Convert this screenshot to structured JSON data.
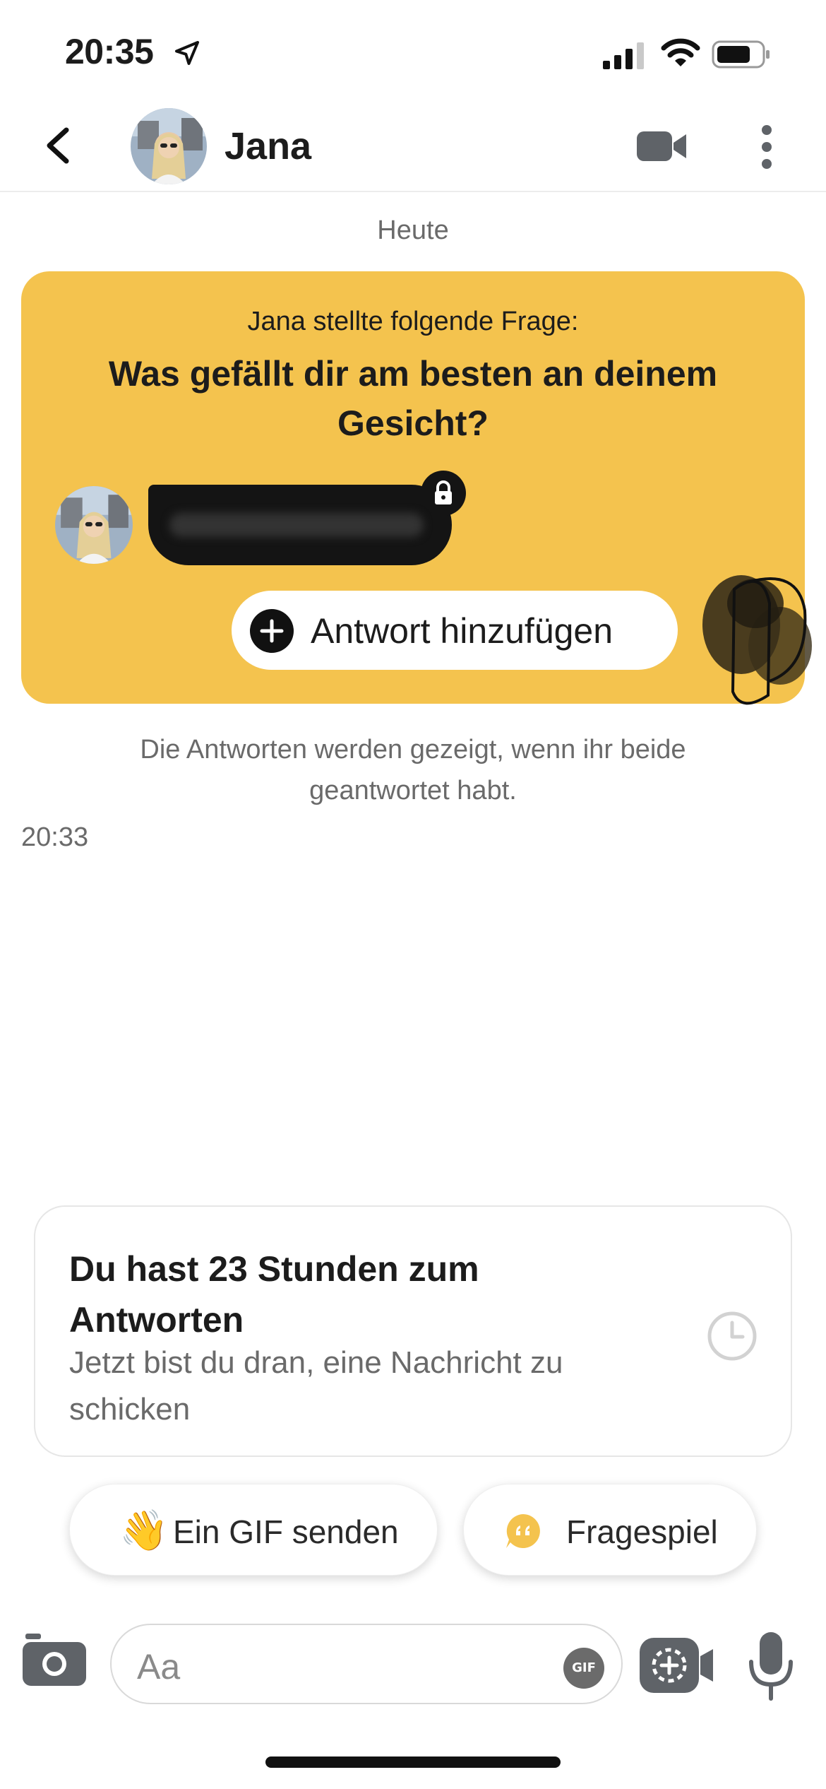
{
  "status_bar": {
    "time": "20:35",
    "icons": [
      "location-arrow-icon",
      "signal-icon",
      "wifi-icon",
      "battery-icon"
    ]
  },
  "header": {
    "contact_name": "Jana",
    "icons": [
      "back-icon",
      "avatar",
      "video-call-icon",
      "more-icon"
    ]
  },
  "chat": {
    "date_divider": "Heute",
    "question_card": {
      "intro": "Jana stellte folgende Frage:",
      "question": "Was gefällt dir am besten an deinem Gesicht?",
      "add_answer_label": "Antwort hinzufügen",
      "accent_color": "#f4c34e"
    },
    "info_text": "Die Antworten werden gezeigt, wenn ihr beide geantwortet habt.",
    "message_time": "20:33"
  },
  "timer_card": {
    "title": "Du hast 23 Stunden zum Antworten",
    "subtitle": "Jetzt bist du dran, eine Nachricht zu schicken"
  },
  "suggestions": [
    {
      "emoji": "👋",
      "label": "Ein GIF senden"
    },
    {
      "icon": "quote-bubble-icon",
      "label": "Fragespiel"
    }
  ],
  "composer": {
    "placeholder": "Aa",
    "gif_badge": "GIF"
  }
}
